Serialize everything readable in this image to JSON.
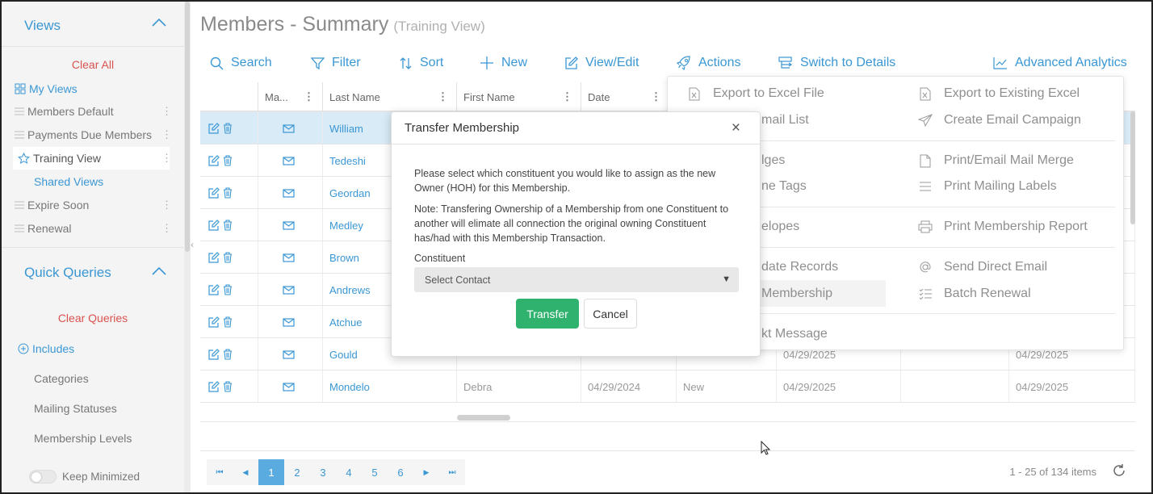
{
  "sidebar": {
    "views_title": "Views",
    "clear_all": "Clear All",
    "my_views": "My Views",
    "items": [
      {
        "label": "Members Default"
      },
      {
        "label": "Payments Due Members"
      },
      {
        "label": "Training View"
      },
      {
        "label": "Shared Views"
      },
      {
        "label": "Expire Soon"
      },
      {
        "label": "Renewal"
      }
    ],
    "quick_queries_title": "Quick Queries",
    "clear_queries": "Clear Queries",
    "includes": "Includes",
    "categories": "Categories",
    "mailing_statuses": "Mailing Statuses",
    "membership_levels": "Membership Levels",
    "keep_minimized": "Keep Minimized"
  },
  "page": {
    "title": "Members - Summary",
    "subtitle": "(Training View)"
  },
  "toolbar": {
    "search": "Search",
    "filter": "Filter",
    "sort": "Sort",
    "new": "New",
    "view_edit": "View/Edit",
    "actions": "Actions",
    "switch": "Switch to Details",
    "analytics": "Advanced Analytics"
  },
  "grid": {
    "headers": {
      "mail": "Ma...",
      "last": "Last Name",
      "first": "First Name",
      "date": "Date"
    },
    "rows": [
      {
        "last": "William",
        "first": "",
        "date": "",
        "type": "",
        "exp": "",
        "last_col": ""
      },
      {
        "last": "Tedeshi",
        "first": "",
        "date": "",
        "type": "",
        "exp": "",
        "last_col": ""
      },
      {
        "last": "Geordan",
        "first": "",
        "date": "",
        "type": "",
        "exp": "",
        "last_col": ""
      },
      {
        "last": "Medley",
        "first": "",
        "date": "",
        "type": "",
        "exp": "",
        "last_col": ""
      },
      {
        "last": "Brown",
        "first": "",
        "date": "",
        "type": "",
        "exp": "",
        "last_col": ""
      },
      {
        "last": "Andrews",
        "first": "",
        "date": "",
        "type": "",
        "exp": "",
        "last_col": ""
      },
      {
        "last": "Atchue",
        "first": "",
        "date": "",
        "type": "",
        "exp": "",
        "last_col": ""
      },
      {
        "last": "Gould",
        "first": "",
        "date": "",
        "type": "",
        "exp": "04/29/2025",
        "last_col": "04/29/2025"
      },
      {
        "last": "Mondelo",
        "first": "Debra",
        "date": "04/29/2024",
        "type": "New",
        "exp": "04/29/2025",
        "last_col": "04/29/2025"
      }
    ],
    "pages": [
      "1",
      "2",
      "3",
      "4",
      "5",
      "6"
    ],
    "count_text": "1 - 25 of 134 items"
  },
  "actions_menu": {
    "left": [
      "Export to Excel File",
      "mail List",
      "lges",
      "ne Tags",
      "elopes",
      "date Records",
      "Membership",
      "kt Message"
    ],
    "right": [
      "Export to Existing Excel",
      "Create Email Campaign",
      "Print/Email Mail Merge",
      "Print Mailing Labels",
      "Print Membership Report",
      "Send Direct Email",
      "Batch Renewal"
    ]
  },
  "modal": {
    "title": "Transfer Membership",
    "close": "×",
    "text1": "Please select which constituent you would like to assign as the new Owner (HOH) for this Membership.",
    "text2": "Note: Transfering Ownership of a Membership from one Constituent to another will elimate all connection the original owning Constituent has/had with this Membership Transaction.",
    "constituent_label": "Constituent",
    "select_placeholder": "Select Contact",
    "transfer": "Transfer",
    "cancel": "Cancel"
  },
  "colors": {
    "accent": "#3a97d4",
    "danger": "#d9534f",
    "success": "#2fb26d"
  }
}
